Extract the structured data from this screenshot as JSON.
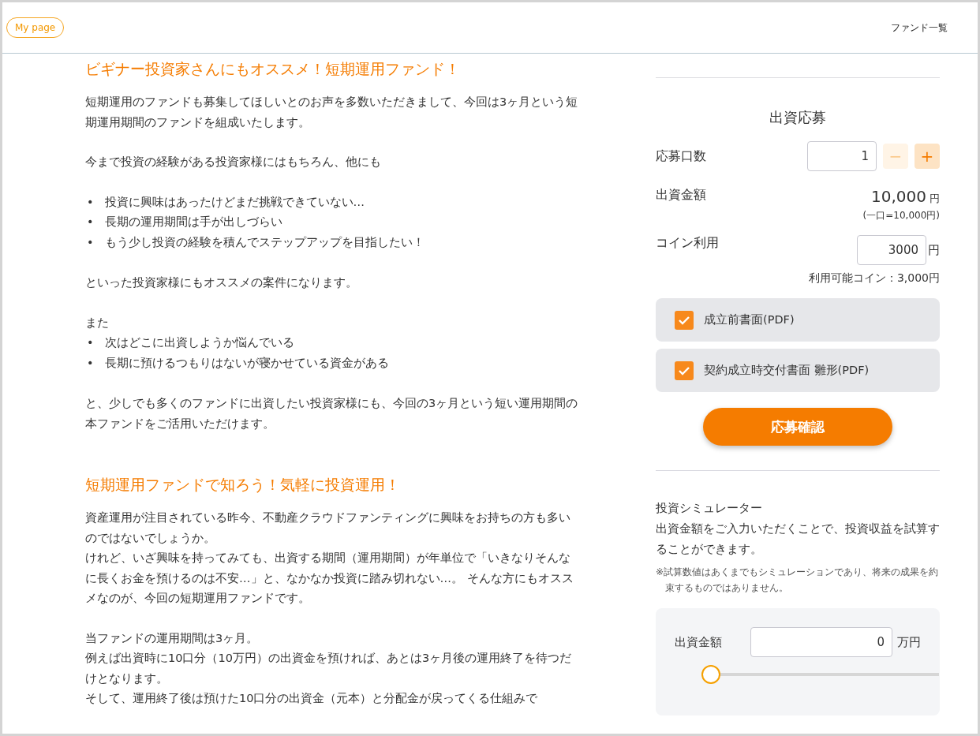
{
  "header": {
    "mypage_button": "My page",
    "nav": [
      "ファンド一覧"
    ]
  },
  "article": [
    {
      "heading": "ビギナー投資家さんにもオススメ！短期運用ファンド！",
      "blocks": [
        {
          "kind": "paragraph",
          "text": "短期運用のファンドも募集してほしいとのお声を多数いただきまして、今回は3ヶ月という短期運用期間のファンドを組成いたします。"
        },
        {
          "kind": "paragraph",
          "text": "今まで投資の経験がある投資家様にはもちろん、他にも"
        },
        {
          "kind": "bullets",
          "marker": "•",
          "items": [
            "投資に興味はあったけどまだ挑戦できていない…",
            "長期の運用期間は手が出しづらい",
            "もう少し投資の経験を積んでステップアップを目指したい！"
          ]
        },
        {
          "kind": "paragraph",
          "text": "といった投資家様にもオススメの案件になります。"
        },
        {
          "kind": "line",
          "text": "また"
        },
        {
          "kind": "bullets",
          "marker": "•",
          "items": [
            "次はどこに出資しようか悩んでいる",
            "長期に預けるつもりはないが寝かせている資金がある"
          ]
        },
        {
          "kind": "paragraph",
          "text": "と、少しでも多くのファンドに出資したい投資家様にも、今回の3ヶ月という短い運用期間の本ファンドをご活用いただけます。"
        }
      ]
    },
    {
      "heading": "短期運用ファンドで知ろう！気軽に投資運用！",
      "blocks": [
        {
          "kind": "line",
          "text": "資産運用が注目されている昨今、不動産クラウドファンティングに興味をお持ちの方も多いのではないでしょうか。"
        },
        {
          "kind": "paragraph",
          "text": "けれど、いざ興味を持ってみても、出資する期間（運用期間）が年単位で「いきなりそんなに長くお金を預けるのは不安…」と、なかなか投資に踏み切れない…。 そんな方にもオススメなのが、今回の短期運用ファンドです。"
        },
        {
          "kind": "line",
          "text": "当ファンドの運用期間は3ヶ月。"
        },
        {
          "kind": "line",
          "text": "例えば出資時に10口分（10万円）の出資金を預ければ、あとは3ヶ月後の運用終了を待つだけとなります。"
        },
        {
          "kind": "line",
          "text": "そして、運用終了後は預けた10口分の出資金（元本）と分配金が戻ってくる仕組みで"
        }
      ]
    }
  ],
  "sidebar": {
    "apply": {
      "title": "出資応募",
      "units_label": "応募口数",
      "units_value": "1",
      "minus": "−",
      "plus": "+",
      "minus_disabled": true,
      "amount_label": "出資金額",
      "amount_value": "10,000",
      "amount_unit": "円",
      "amount_note": "(一口=10,000円)",
      "coin_label": "コイン利用",
      "coin_value": "3000",
      "coin_unit": "円",
      "coin_available": "利用可能コイン：3,000円",
      "documents": [
        {
          "label": "成立前書面(PDF)",
          "checked": true
        },
        {
          "label": "契約成立時交付書面 雛形(PDF)",
          "checked": true
        }
      ],
      "confirm_button": "応募確認"
    },
    "simulator": {
      "title": "投資シミュレーター",
      "description": "出資金額をご入力いただくことで、投資収益を試算することができます。",
      "note": "※試算数値はあくまでもシミュレーションであり、将来の成果を約束するものではありません。",
      "amount_label": "出資金額",
      "amount_value": "0",
      "amount_unit": "万円",
      "slider": {
        "level": 0
      }
    }
  }
}
